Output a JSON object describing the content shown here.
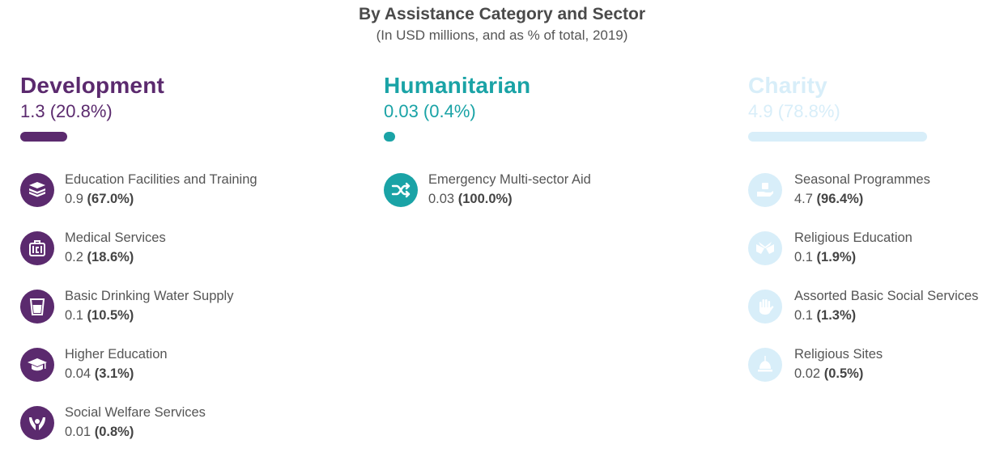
{
  "header": {
    "title": "By Assistance Category and Sector",
    "subtitle": "(In USD millions, and as % of total, 2019)"
  },
  "colors": {
    "development": "#5b2a6e",
    "humanitarian": "#1aa3a6",
    "charity": "#d8eef9"
  },
  "chart_data": {
    "type": "bar",
    "categories": [
      "Development",
      "Humanitarian",
      "Charity"
    ],
    "values": [
      1.3,
      0.03,
      4.9
    ],
    "percent": [
      20.8,
      0.4,
      78.8
    ],
    "unit": "USD millions"
  },
  "categories": [
    {
      "name": "Development",
      "value": "1.3 (20.8%)",
      "items": [
        {
          "name": "Education Facilities and Training",
          "value": "0.9",
          "pct": "(67.0%)",
          "icon": "books-icon"
        },
        {
          "name": "Medical Services",
          "value": "0.2",
          "pct": "(18.6%)",
          "icon": "medical-bag-icon"
        },
        {
          "name": "Basic Drinking Water Supply",
          "value": "0.1",
          "pct": "(10.5%)",
          "icon": "water-glass-icon"
        },
        {
          "name": "Higher Education",
          "value": "0.04",
          "pct": "(3.1%)",
          "icon": "graduation-cap-icon"
        },
        {
          "name": "Social Welfare Services",
          "value": "0.01",
          "pct": "(0.8%)",
          "icon": "caring-hands-icon"
        }
      ]
    },
    {
      "name": "Humanitarian",
      "value": "0.03 (0.4%)",
      "items": [
        {
          "name": "Emergency Multi-sector Aid",
          "value": "0.03",
          "pct": "(100.0%)",
          "icon": "crossing-arrows-icon"
        }
      ]
    },
    {
      "name": "Charity",
      "value": "4.9 (78.8%)",
      "items": [
        {
          "name": "Seasonal Programmes",
          "value": "4.7",
          "pct": "(96.4%)",
          "icon": "giving-hand-icon"
        },
        {
          "name": "Religious Education",
          "value": "0.1",
          "pct": "(1.9%)",
          "icon": "open-book-icon"
        },
        {
          "name": "Assorted Basic Social Services",
          "value": "0.1",
          "pct": "(1.3%)",
          "icon": "hand-icon"
        },
        {
          "name": "Religious Sites",
          "value": "0.02",
          "pct": "(0.5%)",
          "icon": "dome-icon"
        }
      ]
    }
  ]
}
